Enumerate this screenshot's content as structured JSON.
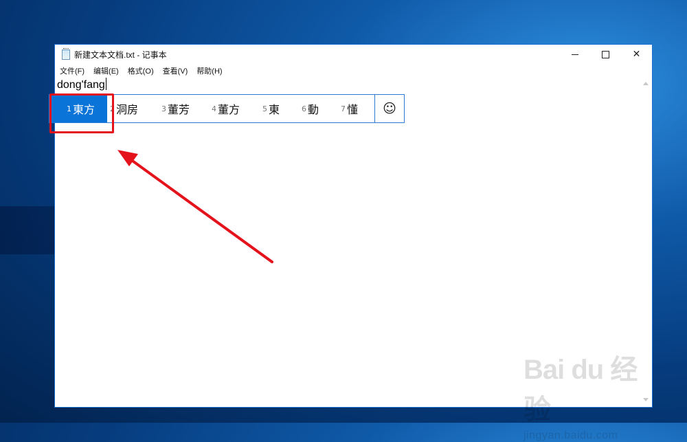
{
  "window": {
    "title": "新建文本文档.txt - 记事本",
    "controls": {
      "close_glyph": "✕"
    }
  },
  "menu": {
    "items": [
      "文件(F)",
      "编辑(E)",
      "格式(O)",
      "查看(V)",
      "帮助(H)"
    ]
  },
  "editor": {
    "typed_text": "dong'fang"
  },
  "ime": {
    "candidates": [
      {
        "num": "1",
        "text": "東方",
        "selected": true
      },
      {
        "num": "2",
        "text": "洞房"
      },
      {
        "num": "3",
        "text": "董芳"
      },
      {
        "num": "4",
        "text": "董方"
      },
      {
        "num": "5",
        "text": "東"
      },
      {
        "num": "6",
        "text": "動"
      },
      {
        "num": "7",
        "text": "懂"
      }
    ],
    "emoji_glyph": "☺",
    "accent_color": "#0a74d8"
  },
  "annotation": {
    "highlight_color": "#e3121b"
  },
  "watermark": {
    "logo_text": "Bai du 经验",
    "url": "jingyan.baidu.com"
  }
}
